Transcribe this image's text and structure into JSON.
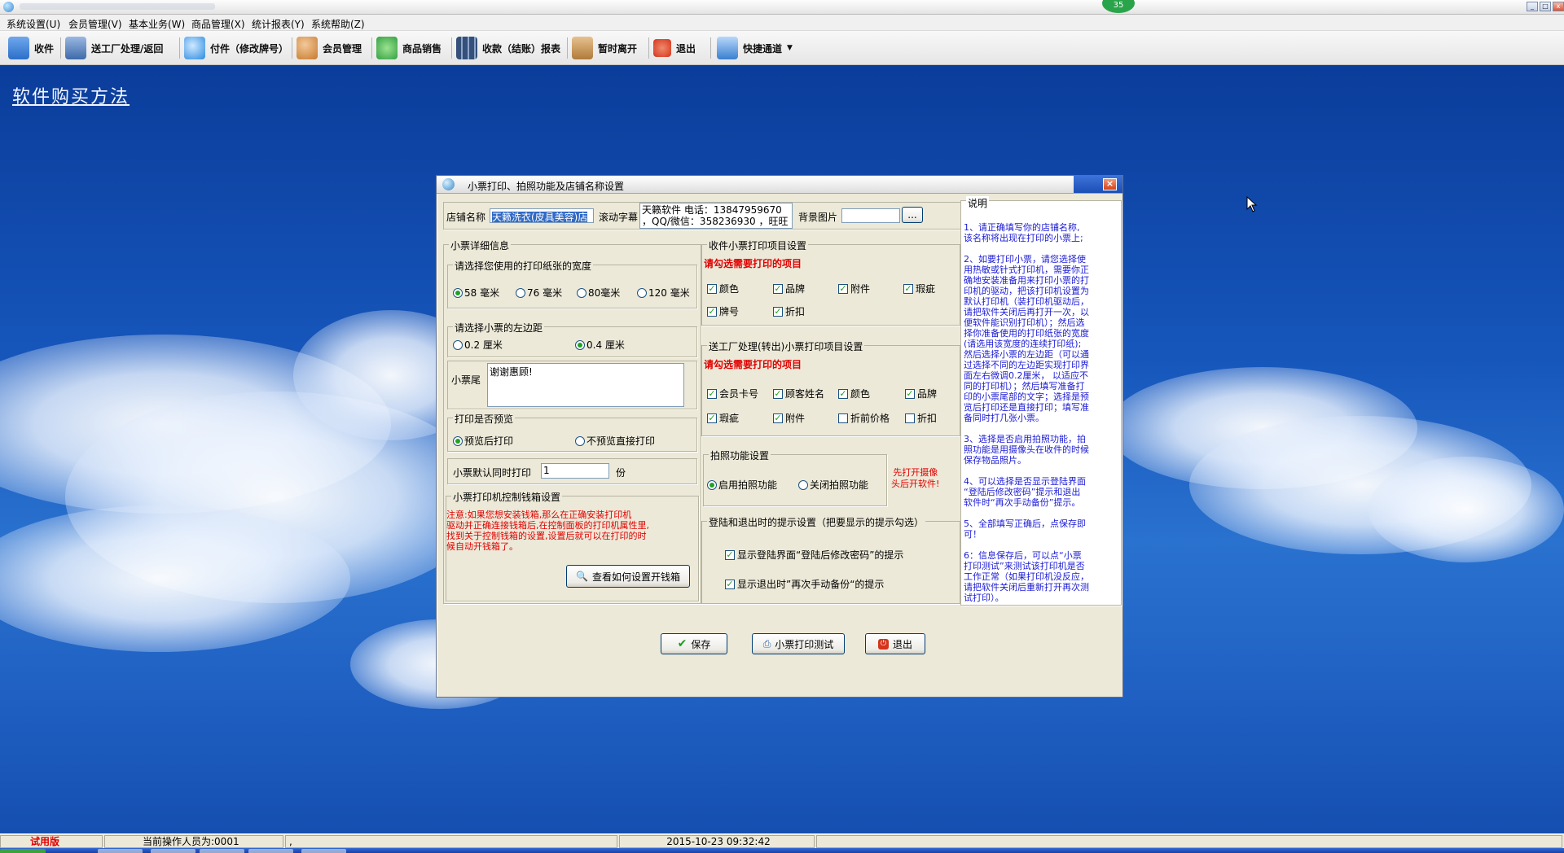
{
  "window": {
    "badge": "35"
  },
  "menu": [
    "系统设置(U)",
    "会员管理(V)",
    "基本业务(W)",
    "商品管理(X)",
    "统计报表(Y)",
    "系统帮助(Z)"
  ],
  "toolbar": [
    {
      "label": "收件",
      "icon": "receive-icon",
      "color": "#2c6fc9"
    },
    {
      "label": "送工厂处理/返回",
      "icon": "truck-icon",
      "color": "#3d6aa8"
    },
    {
      "label": "付件（修改牌号）",
      "icon": "magnifier-icon",
      "color": "#2a8be0"
    },
    {
      "label": "会员管理",
      "icon": "members-icon",
      "color": "#c67a2c"
    },
    {
      "label": "商品销售",
      "icon": "clover-icon",
      "color": "#34a043"
    },
    {
      "label": "收款（结账）报表",
      "icon": "calculator-icon",
      "color": "#35507a"
    },
    {
      "label": "暂时离开",
      "icon": "key-icon",
      "color": "#b07a3a"
    },
    {
      "label": "退出",
      "icon": "exit-icon",
      "color": "#d4351c"
    },
    {
      "label": "快捷通道",
      "icon": "shortcut-icon",
      "color": "#3a7fd0"
    }
  ],
  "desktop": {
    "buy_link": "软件购买方法"
  },
  "dialog": {
    "title": "小票打印、拍照功能及店铺名称设置",
    "shop_name_label": "店铺名称",
    "shop_name_value": "天籁洗衣(皮具美容)店",
    "scroll_label": "滚动字幕",
    "scroll_text_line1": "天籁软件  电话：13847959670",
    "scroll_text_line2": "，QQ/微信：358236930 ，旺旺",
    "bg_label": "背景图片",
    "browse_button": "...",
    "receipt_group": {
      "title": "小票详细信息",
      "width_group_title": "请选择您使用的打印纸张的宽度",
      "widths": [
        "58 毫米",
        "76 毫米",
        "80毫米",
        "120 毫米"
      ],
      "margin_group_title": "请选择小票的左边距",
      "margins": [
        "0.2  厘米",
        "0.4  厘米"
      ],
      "tail_label": "小票尾",
      "tail_value": "谢谢惠顾!",
      "preview_group_title": "打印是否预览",
      "preview_options": [
        "预览后打印",
        "不预览直接打印"
      ],
      "copies_label": "小票默认同时打印",
      "copies_value": "1",
      "copies_unit": "份",
      "cashbox_group_title": "小票打印机控制钱箱设置",
      "cashbox_note_lines": [
        "    注意:如果您想安装钱箱,那么在正确安装打印机",
        "驱动并正确连接钱箱后,在控制面板的打印机属性里,",
        "找到关于控制钱箱的设置,设置后就可以在打印的时",
        "候自动开钱箱了。"
      ],
      "cashbox_button": "查看如何设置开钱箱"
    },
    "receive_print": {
      "title": "收件小票打印项目设置",
      "hint": "请勾选需要打印的项目",
      "items": [
        "颜色",
        "品牌",
        "附件",
        "瑕疵",
        "牌号",
        "折扣"
      ]
    },
    "factory_print": {
      "title": "送工厂处理(转出)小票打印项目设置",
      "hint": "请勾选需要打印的项目",
      "items": [
        "会员卡号",
        "顾客姓名",
        "颜色",
        "品牌",
        "瑕疵",
        "附件",
        "折前价格",
        "折扣"
      ],
      "checked": [
        true,
        true,
        true,
        true,
        true,
        true,
        false,
        false
      ]
    },
    "photo": {
      "title": "拍照功能设置",
      "options": [
        "启用拍照功能",
        "关闭拍照功能"
      ],
      "warning_line1": "先打开摄像",
      "warning_line2": "头后开软件!"
    },
    "login_exit": {
      "title": "登陆和退出时的提示设置（把要显示的提示勾选）",
      "options": [
        "显示登陆界面“登陆后修改密码”的提示",
        "显示退出时”再次手动备份“的提示"
      ]
    },
    "help": {
      "title": "说明",
      "lines": [
        "  1、请正确填写你的店铺名称,",
        "该名称将出现在打印的小票上;",
        "",
        "  2、如要打印小票，请您选择使",
        "用热敏或针式打印机，需要你正",
        "确地安装准备用来打印小票的打",
        "印机的驱动，把该打印机设置为",
        "默认打印机（装打印机驱动后，",
        "请把软件关闭后再打开一次，以",
        "便软件能识别打印机）；然后选",
        "择你准备使用的打印纸张的宽度",
        "(请选用该宽度的连续打印纸);",
        "然后选择小票的左边距（可以通",
        "过选择不同的左边距实现打印界",
        "面左右微调0.2厘米， 以适应不",
        "同的打印机）；然后填写准备打",
        "印的小票尾部的文字；选择是预",
        "览后打印还是直接打印；填写准",
        "备同时打几张小票。",
        "",
        "  3、选择是否启用拍照功能，拍",
        "照功能是用摄像头在收件的时候",
        "保存物品照片。",
        "",
        "  4、可以选择是否显示登陆界面",
        "“登陆后修改密码”提示和退出",
        "软件时“再次手动备份”提示。",
        "",
        "  5、全部填写正确后，点保存即",
        "可！",
        "",
        "  6：信息保存后，可以点“小票",
        "打印测试”来测试该打印机是否",
        "工作正常（如果打印机没反应，",
        "请把软件关闭后重新打开再次测",
        "试打印）。"
      ]
    },
    "buttons": {
      "save": "保存",
      "test": "小票打印测试",
      "exit": "退出"
    }
  },
  "status": {
    "edition": "试用版",
    "operator": "当前操作人员为:0001",
    "mark": ",",
    "datetime": "2015-10-23 09:32:42"
  }
}
